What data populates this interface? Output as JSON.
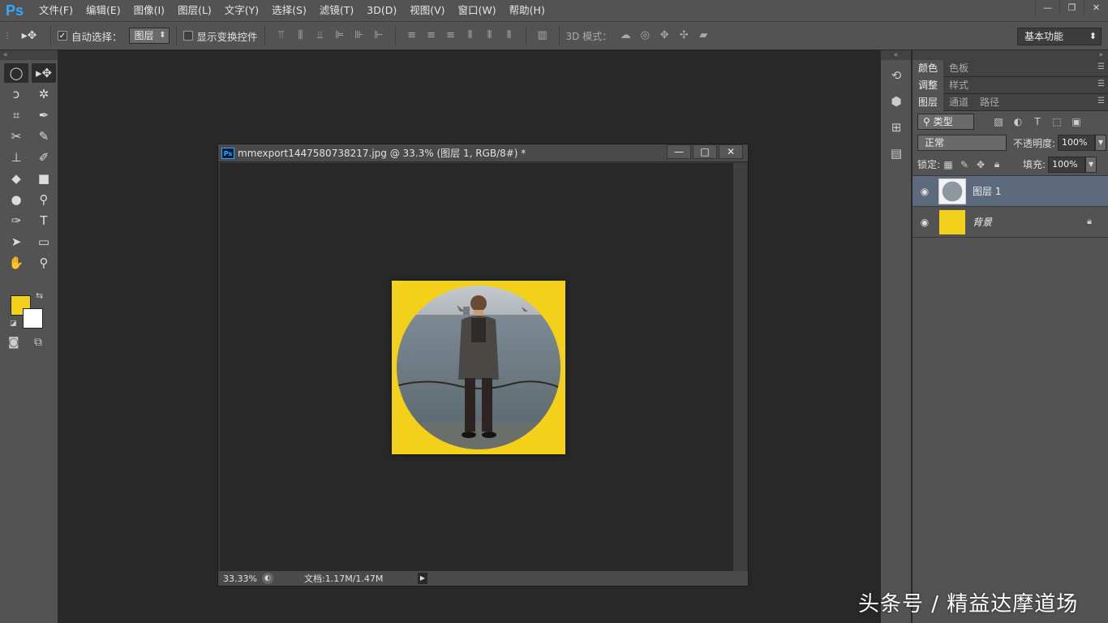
{
  "app": {
    "logo": "Ps"
  },
  "menu": [
    "文件(F)",
    "编辑(E)",
    "图像(I)",
    "图层(L)",
    "文字(Y)",
    "选择(S)",
    "滤镜(T)",
    "3D(D)",
    "视图(V)",
    "窗口(W)",
    "帮助(H)"
  ],
  "options": {
    "auto_select_label": "自动选择：",
    "auto_select_checked": true,
    "auto_select_target": "图层",
    "show_transform_label": "显示变换控件",
    "mode_3d_label": "3D 模式：",
    "workspace": "基本功能"
  },
  "colors": {
    "foreground": "#f3d11a",
    "background": "#ffffff",
    "accent": "#31a8ff",
    "selected_layer": "#5d6a7d"
  },
  "document": {
    "title": "mmexport1447580738217.jpg @ 33.3% (图层 1, RGB/8#) *",
    "zoom": "33.33%",
    "doc_info": "文档:1.17M/1.47M"
  },
  "panels": {
    "top_tabs": [
      "颜色",
      "色板"
    ],
    "adjust_tabs": [
      "调整",
      "样式"
    ],
    "layer_tabs": [
      "图层",
      "通道",
      "路径"
    ],
    "kind_filter": "类型",
    "blend_mode": "正常",
    "opacity_label": "不透明度:",
    "opacity": "100%",
    "lock_label": "锁定:",
    "fill_label": "填充:",
    "fill": "100%",
    "layers": [
      {
        "name": "图层 1",
        "selected": true
      },
      {
        "name": "背景",
        "selected": false,
        "locked": true
      }
    ]
  },
  "watermark": "头条号 / 精益达摩道场"
}
